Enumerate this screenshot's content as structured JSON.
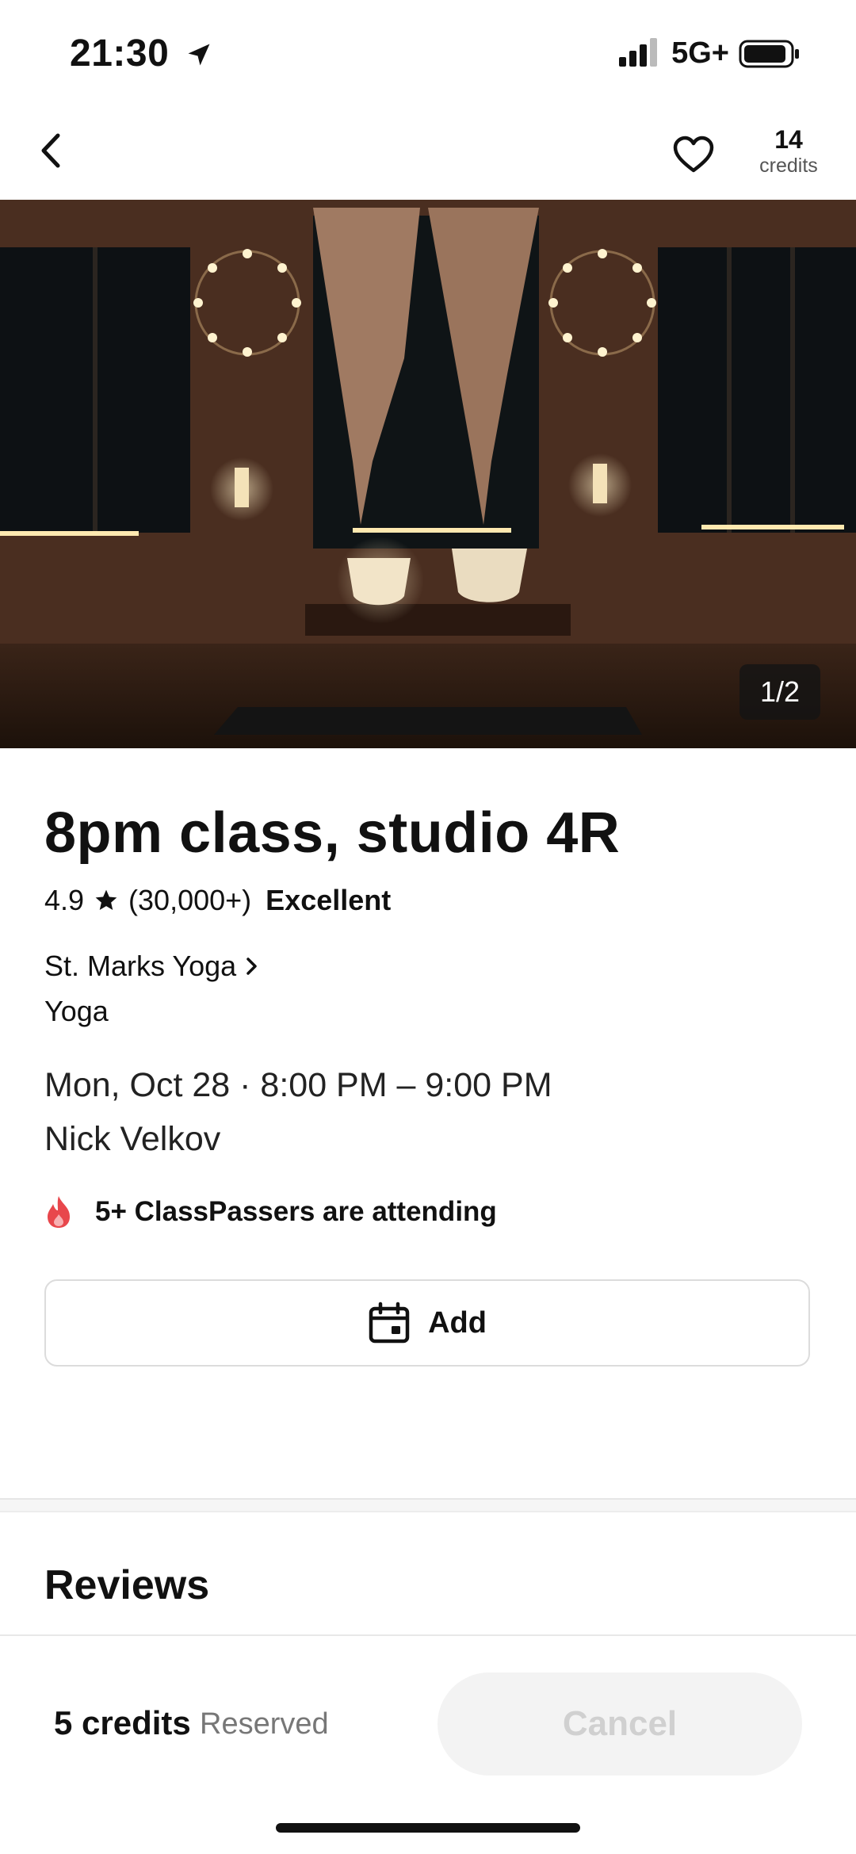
{
  "status_bar": {
    "time": "21:30",
    "network": "5G+"
  },
  "header": {
    "credits_count": "14",
    "credits_label": "credits"
  },
  "hero": {
    "pager": "1/2"
  },
  "class_info": {
    "title": "8pm class, studio 4R",
    "rating": "4.9",
    "rating_count": "(30,000+)",
    "rating_label": "Excellent",
    "studio": "St. Marks Yoga",
    "category": "Yoga",
    "datetime": "Mon, Oct 28 · 8:00 PM – 9:00 PM",
    "instructor": "Nick Velkov",
    "attending": "5+ ClassPassers are attending"
  },
  "actions": {
    "add_label": "Add"
  },
  "reviews": {
    "title": "Reviews"
  },
  "booking": {
    "price": "5 credits",
    "status": "Reserved",
    "cancel_label": "Cancel"
  },
  "colors": {
    "accent_fire": "#e8474c",
    "text": "#111111",
    "muted": "#777777"
  },
  "icons": [
    "location-arrow-icon",
    "signal-icon",
    "battery-icon",
    "back-chevron-icon",
    "heart-icon",
    "star-icon",
    "chevron-right-icon",
    "fire-icon",
    "calendar-icon"
  ]
}
